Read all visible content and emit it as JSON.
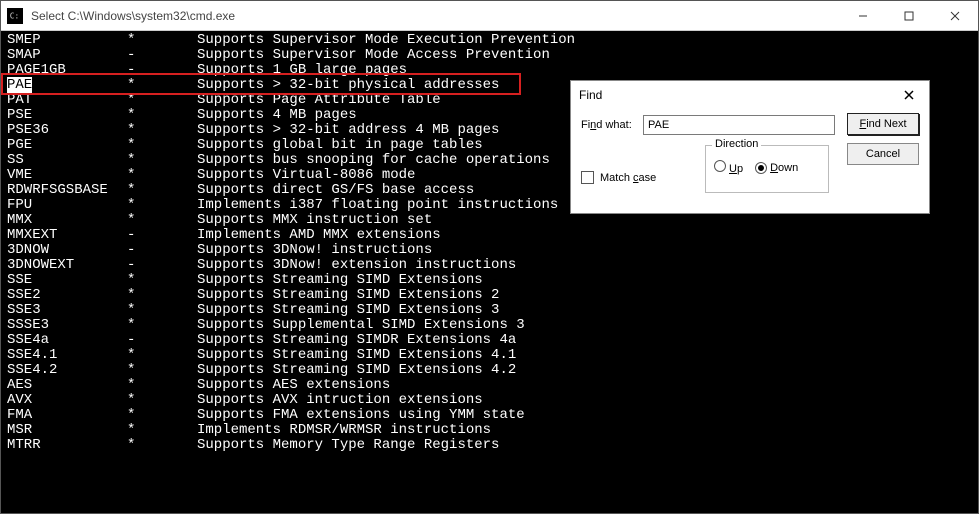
{
  "window": {
    "title": "Select C:\\Windows\\system32\\cmd.exe"
  },
  "terminal": {
    "selected_text": "PAE",
    "rows": [
      {
        "name": "SMEP",
        "flag": "*",
        "desc": "Supports Supervisor Mode Execution Prevention"
      },
      {
        "name": "SMAP",
        "flag": "-",
        "desc": "Supports Supervisor Mode Access Prevention"
      },
      {
        "name": "PAGE1GB",
        "flag": "-",
        "desc": "Supports 1 GB large pages"
      },
      {
        "name": "PAE",
        "flag": "*",
        "desc": "Supports > 32-bit physical addresses"
      },
      {
        "name": "PAT",
        "flag": "*",
        "desc": "Supports Page Attribute Table"
      },
      {
        "name": "PSE",
        "flag": "*",
        "desc": "Supports 4 MB pages"
      },
      {
        "name": "PSE36",
        "flag": "*",
        "desc": "Supports > 32-bit address 4 MB pages"
      },
      {
        "name": "PGE",
        "flag": "*",
        "desc": "Supports global bit in page tables"
      },
      {
        "name": "SS",
        "flag": "*",
        "desc": "Supports bus snooping for cache operations"
      },
      {
        "name": "VME",
        "flag": "*",
        "desc": "Supports Virtual-8086 mode"
      },
      {
        "name": "RDWRFSGSBASE",
        "flag": "*",
        "desc": "Supports direct GS/FS base access"
      },
      {
        "name": "",
        "flag": "",
        "desc": ""
      },
      {
        "name": "FPU",
        "flag": "*",
        "desc": "Implements i387 floating point instructions"
      },
      {
        "name": "MMX",
        "flag": "*",
        "desc": "Supports MMX instruction set"
      },
      {
        "name": "MMXEXT",
        "flag": "-",
        "desc": "Implements AMD MMX extensions"
      },
      {
        "name": "3DNOW",
        "flag": "-",
        "desc": "Supports 3DNow! instructions"
      },
      {
        "name": "3DNOWEXT",
        "flag": "-",
        "desc": "Supports 3DNow! extension instructions"
      },
      {
        "name": "SSE",
        "flag": "*",
        "desc": "Supports Streaming SIMD Extensions"
      },
      {
        "name": "SSE2",
        "flag": "*",
        "desc": "Supports Streaming SIMD Extensions 2"
      },
      {
        "name": "SSE3",
        "flag": "*",
        "desc": "Supports Streaming SIMD Extensions 3"
      },
      {
        "name": "SSSE3",
        "flag": "*",
        "desc": "Supports Supplemental SIMD Extensions 3"
      },
      {
        "name": "SSE4a",
        "flag": "-",
        "desc": "Supports Streaming SIMDR Extensions 4a"
      },
      {
        "name": "SSE4.1",
        "flag": "*",
        "desc": "Supports Streaming SIMD Extensions 4.1"
      },
      {
        "name": "SSE4.2",
        "flag": "*",
        "desc": "Supports Streaming SIMD Extensions 4.2"
      },
      {
        "name": "",
        "flag": "",
        "desc": ""
      },
      {
        "name": "AES",
        "flag": "*",
        "desc": "Supports AES extensions"
      },
      {
        "name": "AVX",
        "flag": "*",
        "desc": "Supports AVX intruction extensions"
      },
      {
        "name": "FMA",
        "flag": "*",
        "desc": "Supports FMA extensions using YMM state"
      },
      {
        "name": "MSR",
        "flag": "*",
        "desc": "Implements RDMSR/WRMSR instructions"
      },
      {
        "name": "MTRR",
        "flag": "*",
        "desc": "Supports Memory Type Range Registers"
      }
    ],
    "highlight_row_index": 3
  },
  "find": {
    "title": "Find",
    "label": "Find what:",
    "value": "PAE",
    "find_next": "Find Next",
    "cancel": "Cancel",
    "match_case": "Match case",
    "direction_label": "Direction",
    "up": "Up",
    "down": "Down",
    "direction_selected": "down"
  }
}
